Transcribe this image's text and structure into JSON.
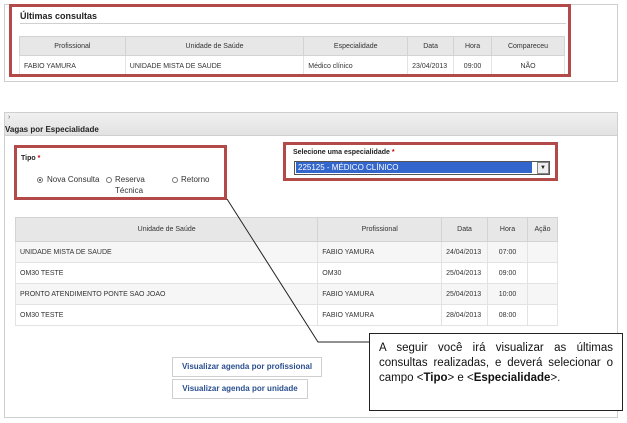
{
  "ultimas": {
    "title": "Últimas consultas",
    "headers": [
      "Profissional",
      "Unidade de Saúde",
      "Especialidade",
      "Data",
      "Hora",
      "Compareceu"
    ],
    "row": [
      "FABIO YAMURA",
      "UNIDADE MISTA DE SAUDE",
      "Médico clínico",
      "23/04/2013",
      "09:00",
      "NÃO"
    ]
  },
  "vagas": {
    "chevron": "›",
    "title": "Vagas por Especialidade",
    "tipo_label": "Tipo",
    "required_mark": "*",
    "radio_nova": "Nova Consulta",
    "radio_reserva_1": "Reserva",
    "radio_reserva_2": "Técnica",
    "radio_retorno": "Retorno",
    "esp_label": "Selecione uma especialidade",
    "esp_value": "225125 - MÉDICO CLÍNICO",
    "arrow_glyph": "▼",
    "headers": [
      "Unidade de Saúde",
      "Profissional",
      "Data",
      "Hora",
      "Ação"
    ],
    "rows": [
      [
        "UNIDADE MISTA DE SAUDE",
        "FABIO YAMURA",
        "24/04/2013",
        "07:00",
        ""
      ],
      [
        "OM30 TESTE",
        "OM30",
        "25/04/2013",
        "09:00",
        ""
      ],
      [
        "PRONTO ATENDIMENTO PONTE SAO JOAO",
        "FABIO YAMURA",
        "25/04/2013",
        "10:00",
        ""
      ],
      [
        "OM30 TESTE",
        "FABIO YAMURA",
        "28/04/2013",
        "08:00",
        ""
      ]
    ],
    "btn_prof": "Visualizar agenda por profissional",
    "btn_unid": "Visualizar agenda por unidade"
  },
  "callout": {
    "text1": "A seguir você irá visualizar as últimas consultas realizadas, e deverá selecionar o campo <",
    "bold1": "Tipo",
    "text2": "> e <",
    "bold2": "Especialidade",
    "text3": ">."
  }
}
